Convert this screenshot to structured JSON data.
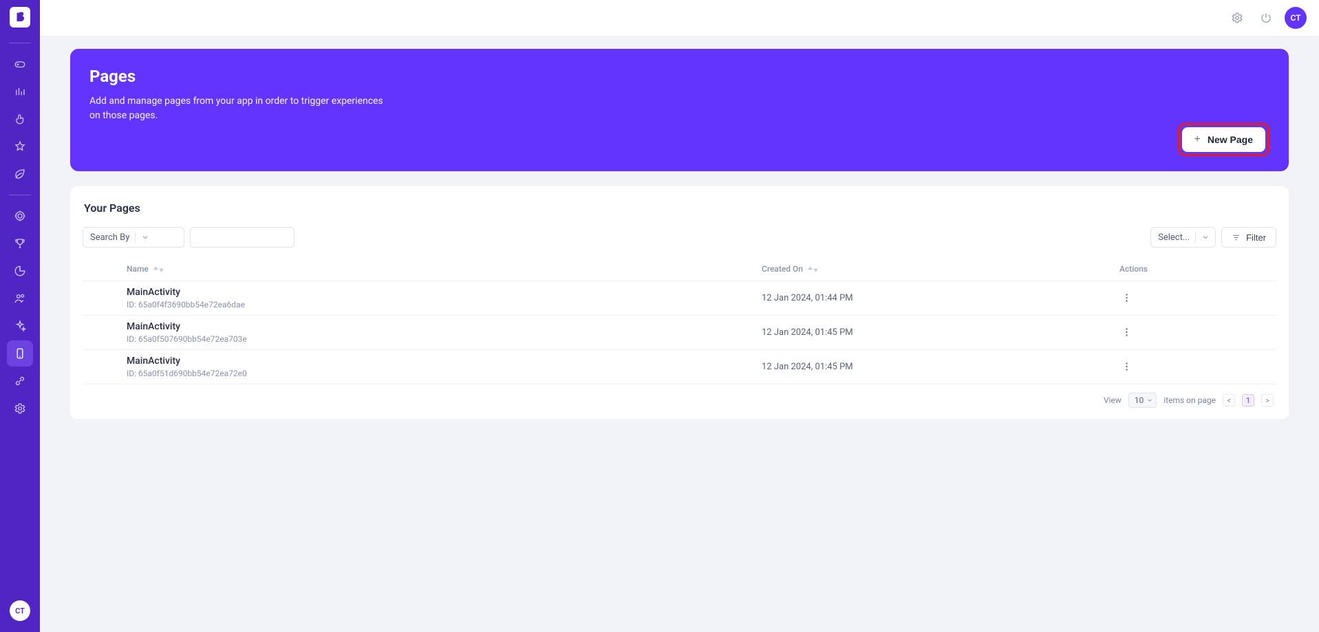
{
  "avatar_initials": "CT",
  "hero": {
    "title": "Pages",
    "description": "Add and manage pages from your app in order to trigger experiences on those pages.",
    "new_page_label": "New Page"
  },
  "card": {
    "title": "Your Pages",
    "search_by_label": "Search By",
    "select_placeholder": "Select...",
    "filter_label": "Filter"
  },
  "table": {
    "headers": {
      "name": "Name",
      "created_on": "Created On",
      "actions": "Actions"
    },
    "rows": [
      {
        "name": "MainActivity",
        "id_label": "ID: 65a0f4f3690bb54e72ea6dae",
        "created": "12 Jan 2024, 01:44 PM"
      },
      {
        "name": "MainActivity",
        "id_label": "ID: 65a0f507690bb54e72ea703e",
        "created": "12 Jan 2024, 01:45 PM"
      },
      {
        "name": "MainActivity",
        "id_label": "ID: 65a0f51d690bb54e72ea72e0",
        "created": "12 Jan 2024, 01:45 PM"
      }
    ]
  },
  "pagination": {
    "view_label": "View",
    "items_label": "items on page",
    "page_size": "10",
    "current_page": "1",
    "prev": "<",
    "next": ">"
  }
}
